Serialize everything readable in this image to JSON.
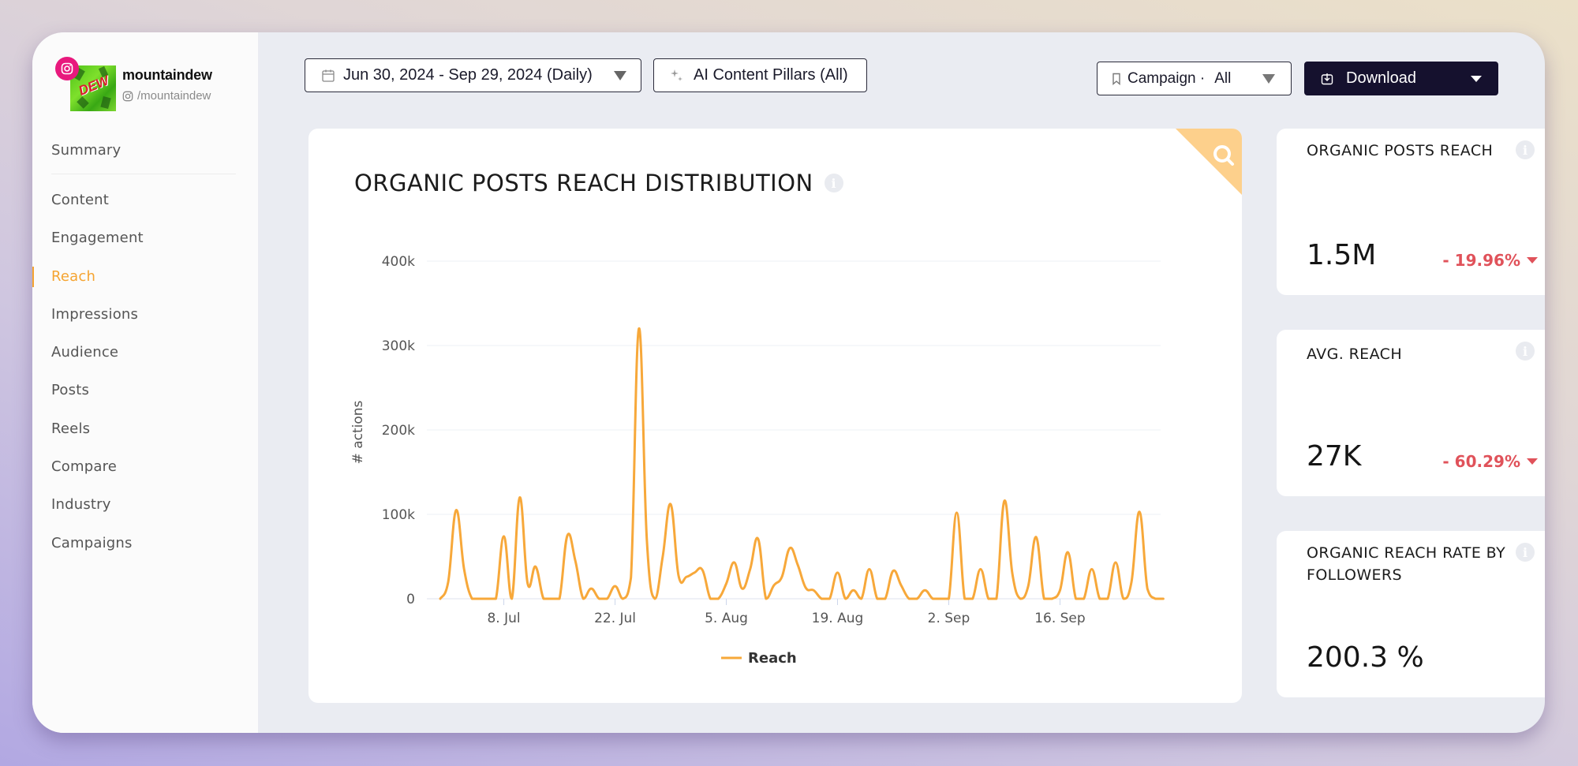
{
  "profile": {
    "name": "mountaindew",
    "handle": "/mountaindew",
    "network_badge": "instagram-icon",
    "avatar_text": "DEW"
  },
  "sidebar": {
    "items": [
      {
        "label": "Summary",
        "active": false
      },
      {
        "label": "Content",
        "active": false
      },
      {
        "label": "Engagement",
        "active": false
      },
      {
        "label": "Reach",
        "active": true
      },
      {
        "label": "Impressions",
        "active": false
      },
      {
        "label": "Audience",
        "active": false
      },
      {
        "label": "Posts",
        "active": false
      },
      {
        "label": "Reels",
        "active": false
      },
      {
        "label": "Compare",
        "active": false
      },
      {
        "label": "Industry",
        "active": false
      },
      {
        "label": "Campaigns",
        "active": false
      }
    ]
  },
  "toolbar": {
    "date_range": "Jun 30, 2024 - Sep 29, 2024 (Daily)",
    "pillars": "AI Content Pillars (All)",
    "campaign_label": "Campaign ·",
    "campaign_value": "All",
    "download": "Download"
  },
  "chart_card": {
    "title": "ORGANIC POSTS REACH DISTRIBUTION",
    "zoom_icon": "search-icon"
  },
  "kpis": [
    {
      "title": "ORGANIC POSTS REACH",
      "value": "1.5M",
      "change": "- 19.96%",
      "direction": "down"
    },
    {
      "title": "AVG. REACH",
      "value": "27K",
      "change": "- 60.29%",
      "direction": "down"
    },
    {
      "title": "ORGANIC REACH RATE BY FOLLOWERS",
      "value": "200.3 %",
      "change": null,
      "direction": null
    }
  ],
  "colors": {
    "accent": "#f5a431",
    "line": "#f7a83a",
    "negative": "#e0525a",
    "download_bg": "#15112e",
    "corner": "#fdd08c"
  },
  "chart_data": {
    "type": "line",
    "title": "ORGANIC POSTS REACH DISTRIBUTION",
    "xlabel": "",
    "ylabel": "# actions",
    "ylim": [
      0,
      400000
    ],
    "yticks": [
      0,
      100000,
      200000,
      300000,
      400000
    ],
    "ytick_labels": [
      "0",
      "100k",
      "200k",
      "300k",
      "400k"
    ],
    "x_start": "2024-06-30",
    "x_end": "2024-09-29",
    "xtick_labels": [
      "8. Jul",
      "22. Jul",
      "5. Aug",
      "19. Aug",
      "2. Sep",
      "16. Sep"
    ],
    "xtick_day_offsets": [
      8,
      22,
      36,
      50,
      64,
      78
    ],
    "grid": true,
    "legend": "bottom-center",
    "series": [
      {
        "name": "Reach",
        "values": [
          0,
          20000,
          105000,
          35000,
          0,
          0,
          0,
          0,
          74000,
          0,
          120000,
          18000,
          38000,
          0,
          0,
          0,
          75000,
          45000,
          0,
          12000,
          0,
          0,
          15000,
          0,
          25000,
          320000,
          70000,
          0,
          50000,
          112000,
          27000,
          26000,
          31000,
          34000,
          0,
          0,
          18000,
          43000,
          12000,
          35000,
          71000,
          0,
          16000,
          26000,
          60000,
          40000,
          13000,
          10000,
          0,
          0,
          31000,
          0,
          10000,
          0,
          35000,
          0,
          0,
          33000,
          16000,
          0,
          0,
          10000,
          0,
          0,
          0,
          102000,
          0,
          0,
          35000,
          0,
          0,
          116000,
          30000,
          0,
          15000,
          73000,
          0,
          0,
          10000,
          55000,
          0,
          0,
          35000,
          0,
          0,
          43000,
          0,
          20000,
          103000,
          12000,
          0,
          0
        ]
      }
    ]
  }
}
